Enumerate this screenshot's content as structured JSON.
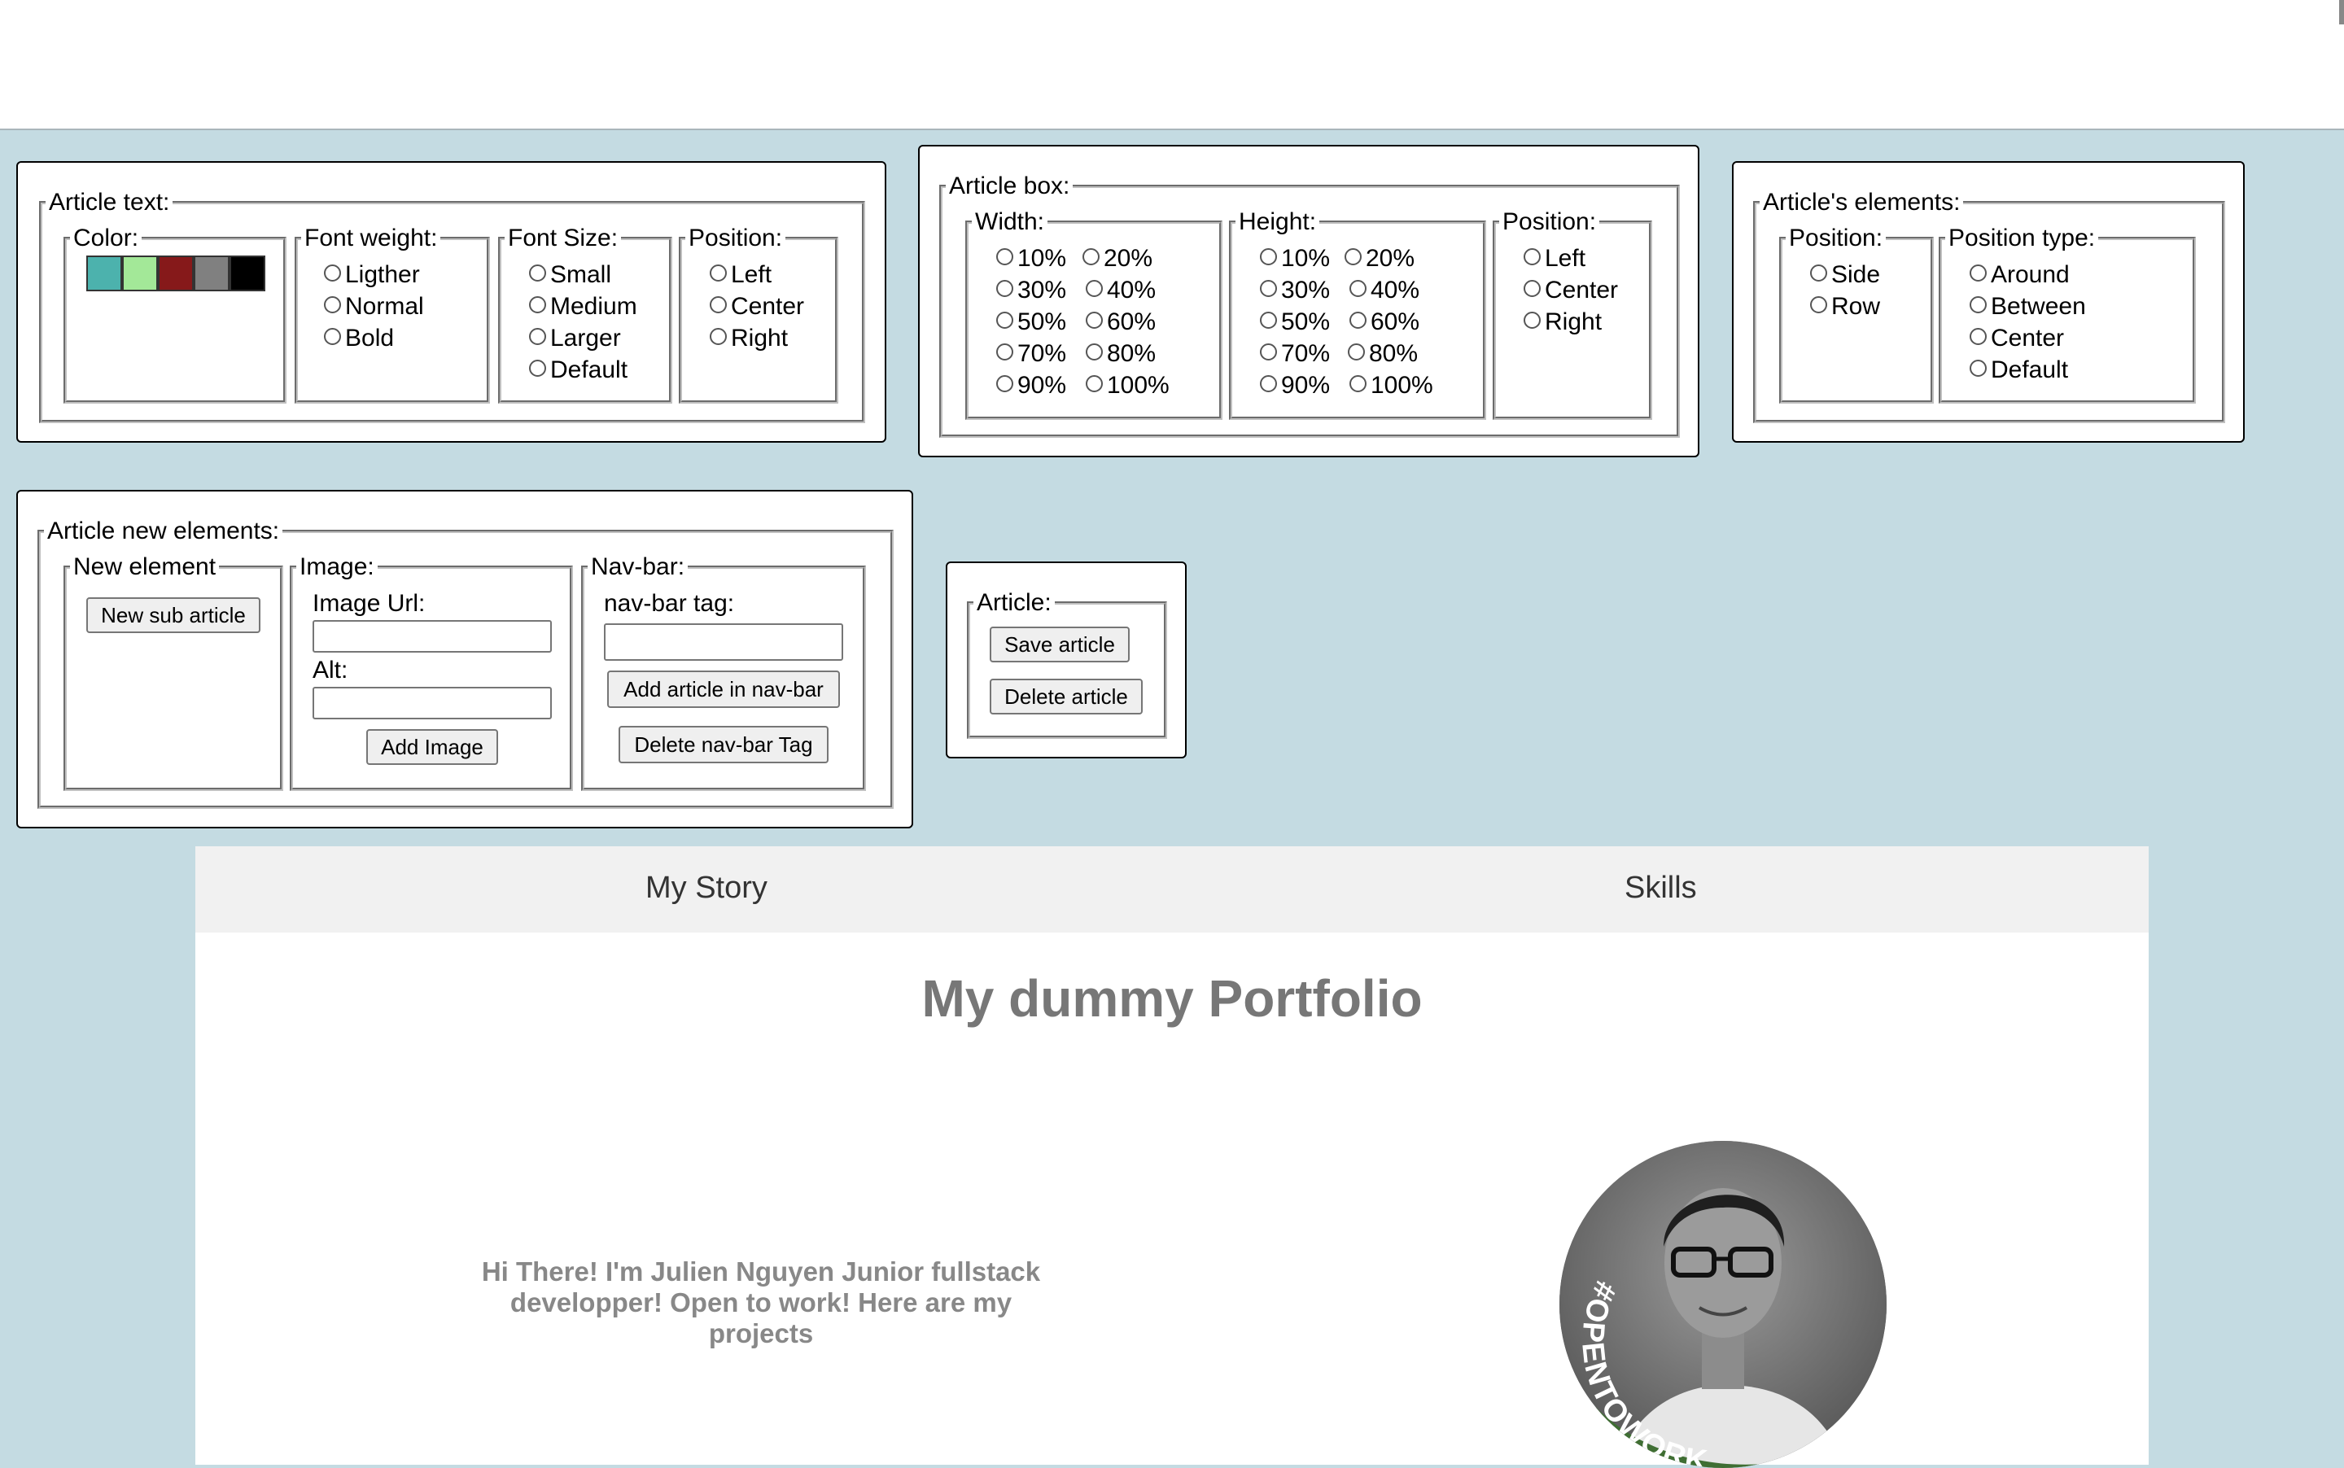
{
  "article_text": {
    "legend": "Article text:",
    "color": {
      "legend": "Color:",
      "swatches": [
        "#4cb2ad",
        "#a3e898",
        "#86191a",
        "#808080",
        "#000000"
      ]
    },
    "font_weight": {
      "legend": "Font weight:",
      "options": [
        "Ligther",
        "Normal",
        "Bold"
      ]
    },
    "font_size": {
      "legend": "Font Size:",
      "options": [
        "Small",
        "Medium",
        "Larger",
        "Default"
      ]
    },
    "position": {
      "legend": "Position:",
      "options": [
        "Left",
        "Center",
        "Right"
      ]
    }
  },
  "article_box": {
    "legend": "Article box:",
    "width": {
      "legend": "Width:",
      "options": [
        "10%",
        "20%",
        "30%",
        "40%",
        "50%",
        "60%",
        "70%",
        "80%",
        "90%",
        "100%"
      ]
    },
    "height": {
      "legend": "Height:",
      "options": [
        "10%",
        "20%",
        "30%",
        "40%",
        "50%",
        "60%",
        "70%",
        "80%",
        "90%",
        "100%"
      ]
    },
    "position": {
      "legend": "Position:",
      "options": [
        "Left",
        "Center",
        "Right"
      ]
    }
  },
  "article_elements": {
    "legend": "Article's elements:",
    "position": {
      "legend": "Position:",
      "options": [
        "Side",
        "Row"
      ]
    },
    "position_type": {
      "legend": "Position type:",
      "options": [
        "Around",
        "Between",
        "Center",
        "Default"
      ]
    }
  },
  "article_new_elements": {
    "legend": "Article new elements:",
    "new_element": {
      "legend": "New element",
      "button": "New sub article"
    },
    "image": {
      "legend": "Image:",
      "url_label": "Image Url:",
      "alt_label": "Alt:",
      "button": "Add Image"
    },
    "navbar": {
      "legend": "Nav-bar:",
      "tag_label": "nav-bar tag:",
      "add_button": "Add article in nav-bar",
      "delete_button": "Delete nav-bar Tag"
    }
  },
  "article": {
    "legend": "Article:",
    "save_button": "Save article",
    "delete_button": "Delete article"
  },
  "site_nav": {
    "links": [
      "My Story",
      "Skills"
    ]
  },
  "portfolio": {
    "title": "My dummy Portfolio",
    "intro": "Hi There! I'm Julien Nguyen Junior fullstack developper! Open to work! Here are my projects",
    "badge": "#OPENTOWORK",
    "colors": {
      "badge_green": "#3f6e33"
    }
  }
}
